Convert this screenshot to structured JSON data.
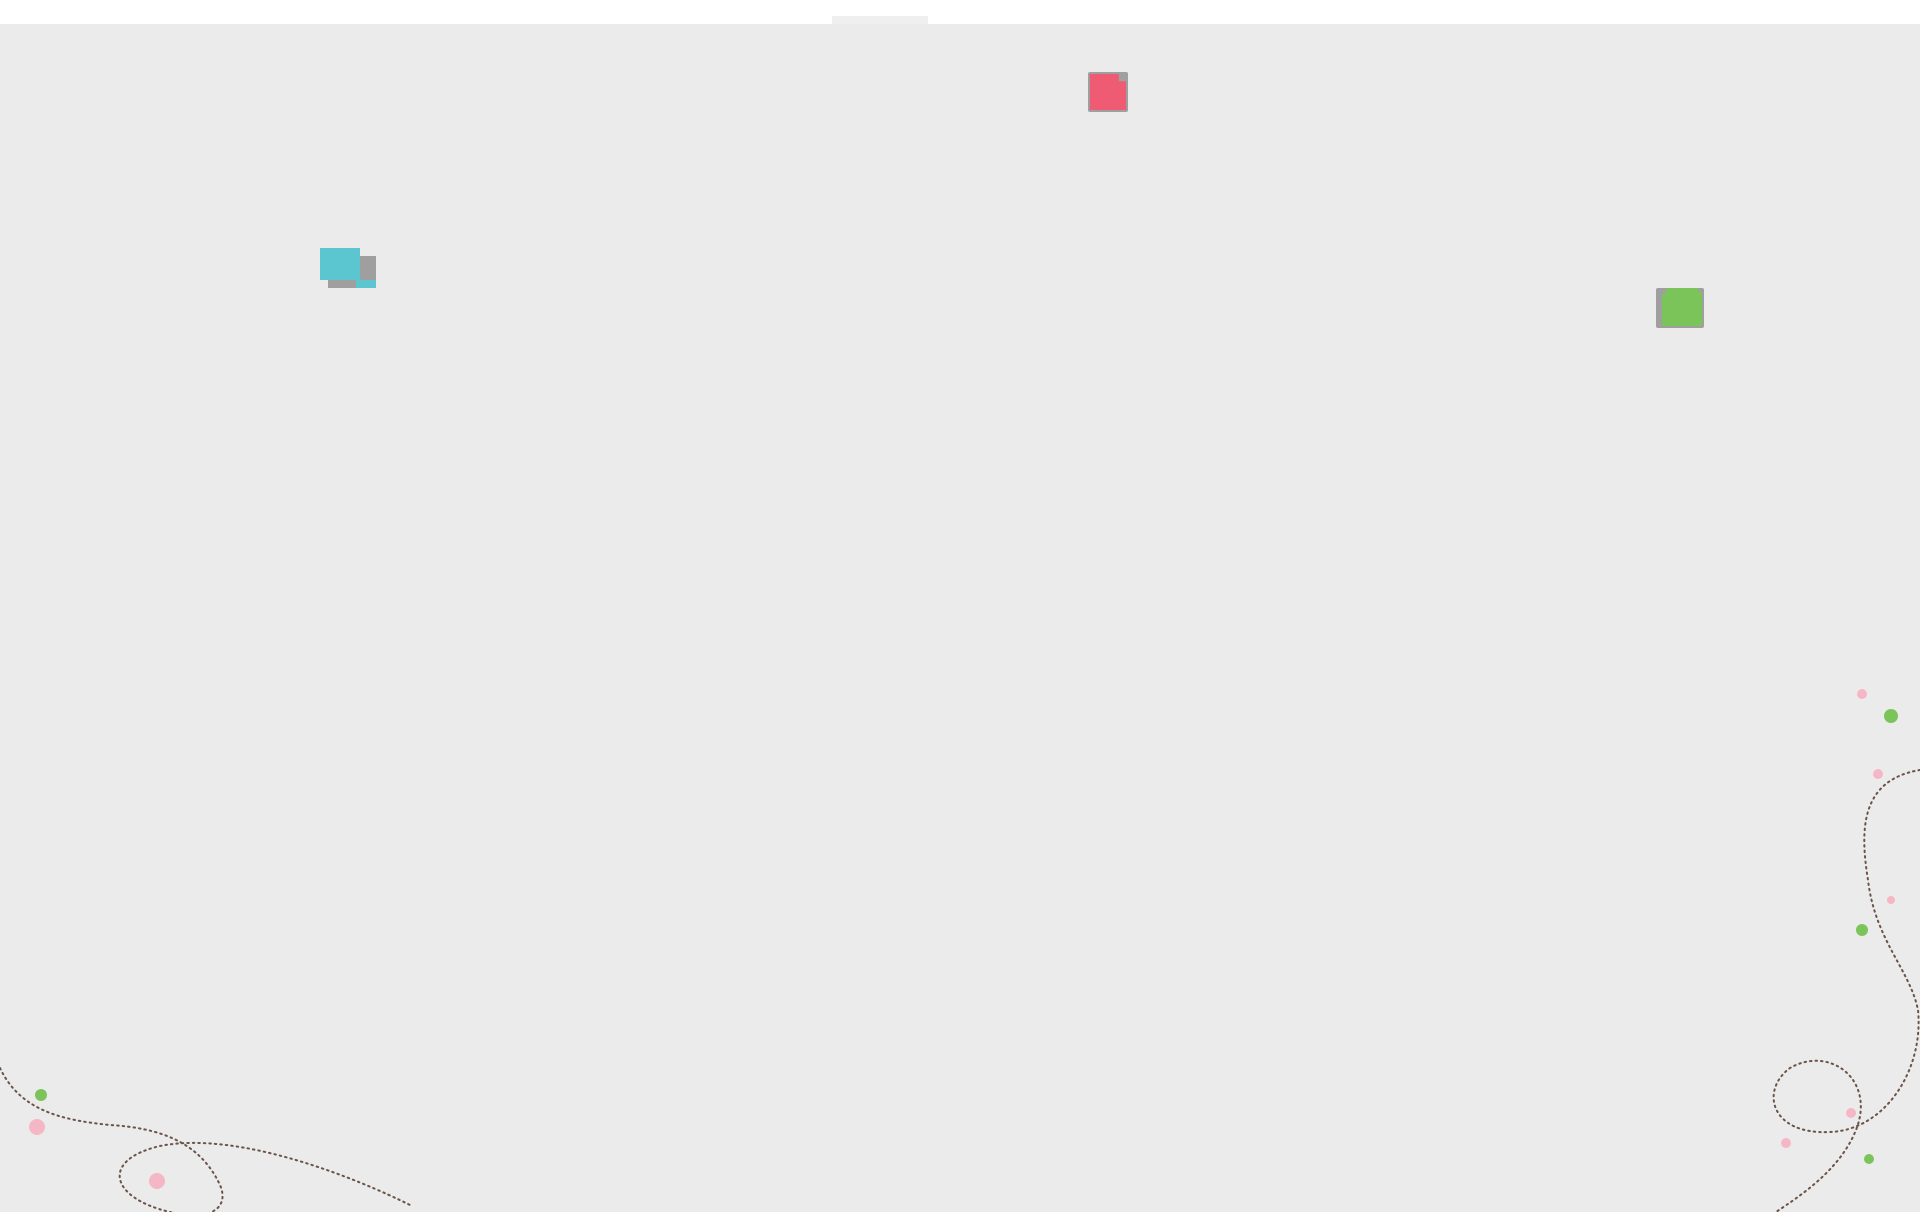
{
  "game": {
    "colors": {
      "background": "#ebebeb",
      "topbar": "#ffffff",
      "shadow": "#9f9f9f",
      "cyan": "#5bc6cf",
      "red": "#ef5b73",
      "green": "#7bc45a",
      "pink": "#f5b7c5",
      "path": "#6b5348"
    },
    "sprites": [
      {
        "name": "cyan-sprite",
        "color": "cyan"
      },
      {
        "name": "red-sprite",
        "color": "red"
      },
      {
        "name": "green-sprite",
        "color": "green"
      }
    ],
    "decor": [
      {
        "name": "bottom-left-vine",
        "color": "path"
      },
      {
        "name": "bottom-right-vine",
        "color": "path"
      },
      {
        "name": "pink-dots",
        "color": "pink"
      },
      {
        "name": "green-dots",
        "color": "green"
      }
    ]
  }
}
